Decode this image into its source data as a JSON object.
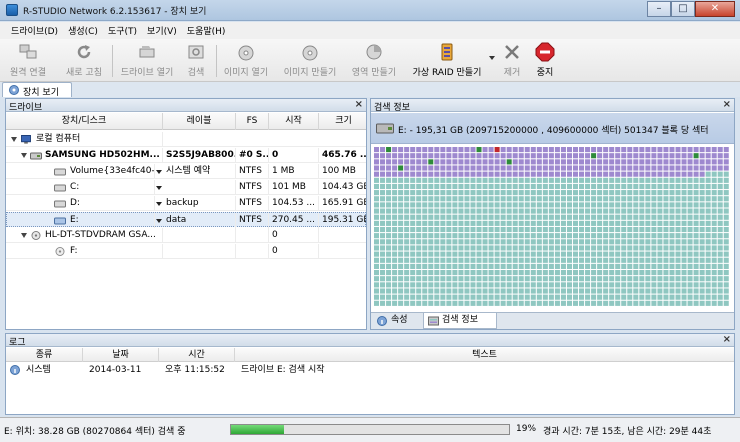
{
  "window": {
    "title": "R-STUDIO Network 6.2.153617 - 장치 보기",
    "minimize": "–",
    "maximize": "□",
    "close": "✕"
  },
  "menu": [
    "드라이브(D)",
    "생성(C)",
    "도구(T)",
    "보기(V)",
    "도움말(H)"
  ],
  "toolbar": {
    "connect": "원격 연결",
    "refresh": "새로 고침",
    "open_drive": "드라이브 열기",
    "scan": "검색",
    "open_image": "이미지 열기",
    "create_image": "이미지 만들기",
    "create_region": "영역 만들기",
    "create_raid": "가상 RAID 만들기",
    "remove": "제거",
    "stop": "중지"
  },
  "tabs": {
    "device_view": "장치 보기"
  },
  "drives_panel": {
    "title": "드라이브",
    "close": "×",
    "columns": {
      "device": "장치/디스크",
      "label": "레이블",
      "fs": "FS",
      "start": "시작",
      "size": "크기"
    },
    "rows": [
      {
        "name": "로컬 컴퓨터",
        "label": "",
        "fs": "",
        "start": "",
        "size": ""
      },
      {
        "name": "SAMSUNG HD502HM...",
        "label": "S2S5J9AB800...",
        "fs": "#0 S...",
        "start": "0",
        "size": "465.76 ..."
      },
      {
        "name": "Volume{33e4fc40-d...",
        "label": "시스템 예약",
        "fs": "NTFS",
        "start": "1 MB",
        "size": "100 MB"
      },
      {
        "name": "C:",
        "label": "",
        "fs": "NTFS",
        "start": "101 MB",
        "size": "104.43 GB"
      },
      {
        "name": "D:",
        "label": "backup",
        "fs": "NTFS",
        "start": "104.53 ...",
        "size": "165.91 GB"
      },
      {
        "name": "E:",
        "label": "data",
        "fs": "NTFS",
        "start": "270.45 ...",
        "size": "195.31 GB"
      },
      {
        "name": "HL-DT-STDVDRAM GSA...",
        "label": "",
        "fs": "",
        "start": "0",
        "size": ""
      },
      {
        "name": "F:",
        "label": "",
        "fs": "",
        "start": "0",
        "size": ""
      }
    ]
  },
  "search_panel": {
    "title": "검색 정보",
    "close": "×",
    "info": "E: - 195,31 GB (209715200000 , 409600000 섹터) 501347 블록 당 섹터",
    "tab_properties": "속성",
    "tab_search": "검색 정보",
    "colors": {
      "grid": "#8fc7c1",
      "scanned": "#9e89cf",
      "found": "#2e8b3a",
      "error": "#c1272d"
    }
  },
  "log_panel": {
    "title": "로그",
    "close": "×",
    "columns": {
      "type": "종류",
      "date": "날짜",
      "time": "시간",
      "text": "텍스트"
    },
    "rows": [
      {
        "type": "시스템",
        "date": "2014-03-11",
        "time": "오후 11:15:52",
        "text": "드라이브 E: 검색 시작"
      }
    ]
  },
  "status": {
    "position": "E: 위치: 38.28 GB (80270864 섹터) 검색 중",
    "progress_fraction": 0.19,
    "percent": "19%",
    "time": "경과 시간: 7분 15초, 남은 시간: 29분 44초"
  }
}
